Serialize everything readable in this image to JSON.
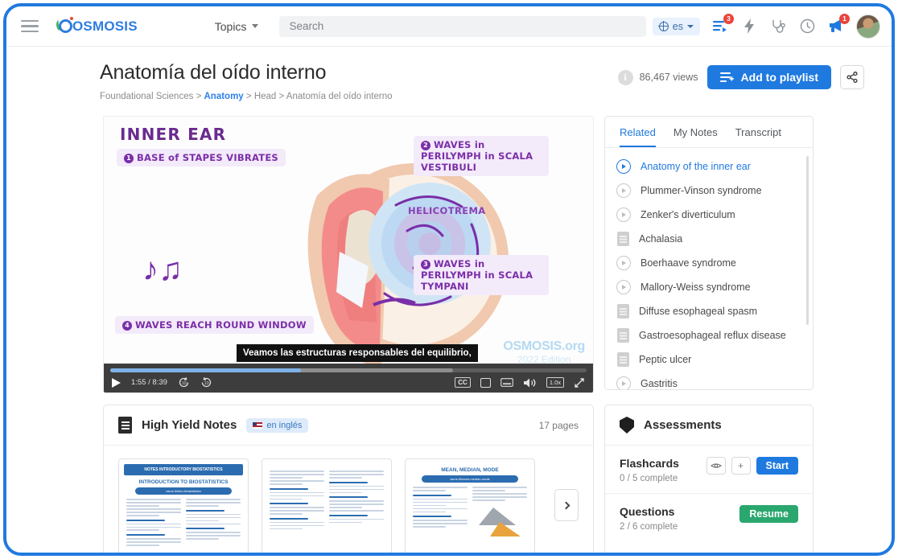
{
  "topnav": {
    "menu_icon": "hamburger-icon",
    "brand": "OSMOSIS",
    "topics_label": "Topics",
    "search_placeholder": "Search",
    "language": "es",
    "playlist_badge": "3",
    "announce_badge": "1",
    "icons": [
      "playlist-icon",
      "bolt-icon",
      "stethoscope-icon",
      "clock-icon",
      "megaphone-icon",
      "avatar"
    ]
  },
  "header": {
    "title": "Anatomía del oído interno",
    "breadcrumb": {
      "root": "Foundational Sciences",
      "sep": ">",
      "link": "Anatomy",
      "mid": "Head",
      "current": "Anatomía del oído interno"
    },
    "views": "86,467 views",
    "add_to_playlist": "Add to playlist",
    "share_icon": "share-icon"
  },
  "video": {
    "heading": "INNER EAR",
    "callouts": [
      {
        "num": "1",
        "text": "BASE of STAPES VIBRATES"
      },
      {
        "num": "2",
        "text": "WAVES in PERILYMPH in SCALA VESTIBULI"
      },
      {
        "num": "3",
        "text": "WAVES in PERILYMPH in SCALA TYMPANI"
      },
      {
        "num": "4",
        "text": "WAVES REACH ROUND WINDOW"
      }
    ],
    "helicotrema": "HELICOTREMA",
    "watermark_line1": "OSMOSIS.org",
    "watermark_line2": "2022 Edition",
    "subtitle": "Veamos las estructuras responsables del equilibrio,",
    "current_time": "1:55",
    "duration": "8:39",
    "timecode": "1:55 / 8:39",
    "speed": "1.0x",
    "cc": "CC",
    "controls": [
      "play-button",
      "rewind-10-icon",
      "forward-10-icon",
      "cc-button",
      "picture-in-picture-icon",
      "keyboard-icon",
      "volume-icon",
      "speed-button",
      "fullscreen-icon"
    ]
  },
  "related_panel": {
    "tabs": [
      {
        "label": "Related",
        "active": true
      },
      {
        "label": "My Notes",
        "active": false
      },
      {
        "label": "Transcript",
        "active": false
      }
    ],
    "items": [
      {
        "label": "Anatomy of the inner ear",
        "type": "video",
        "active": true
      },
      {
        "label": "Plummer-Vinson syndrome",
        "type": "video",
        "active": false
      },
      {
        "label": "Zenker's diverticulum",
        "type": "video",
        "active": false
      },
      {
        "label": "Achalasia",
        "type": "document",
        "active": false
      },
      {
        "label": "Boerhaave syndrome",
        "type": "video",
        "active": false
      },
      {
        "label": "Mallory-Weiss syndrome",
        "type": "video",
        "active": false
      },
      {
        "label": "Diffuse esophageal spasm",
        "type": "document",
        "active": false
      },
      {
        "label": "Gastroesophageal reflux disease",
        "type": "document",
        "active": false
      },
      {
        "label": "Peptic ulcer",
        "type": "document",
        "active": false
      },
      {
        "label": "Gastritis",
        "type": "video",
        "active": false
      }
    ]
  },
  "notes": {
    "title": "High Yield Notes",
    "lang_badge": "en inglés",
    "pages": "17 pages",
    "thumbnails": [
      {
        "band": "NOTES  INTRODUCTORY BIOSTATISTICS",
        "heading": "INTRODUCTION TO BIOSTATISTICS",
        "pill": "osms.it/intro-biostatistics"
      },
      {
        "band": "",
        "heading": "",
        "pill": ""
      },
      {
        "band": "",
        "heading": "MEAN, MEDIAN, MODE",
        "pill": "osms.it/mean-median-mode"
      }
    ],
    "next_label": "next-page"
  },
  "assessments": {
    "title": "Assessments",
    "rows": [
      {
        "name": "Flashcards",
        "progress": "0 / 5 complete",
        "actions": [
          "preview-icon",
          "add-icon"
        ],
        "button": "Start",
        "button_color": "#1f7ae0"
      },
      {
        "name": "Questions",
        "progress": "2 / 6 complete",
        "actions": [],
        "button": "Resume",
        "button_color": "#2aa76e"
      }
    ]
  },
  "colors": {
    "brand_blue": "#2f7de1",
    "accent_blue": "#1f7ae0",
    "green": "#2aa76e",
    "purple": "#7a2ea8",
    "badge_red": "#e8453c"
  }
}
